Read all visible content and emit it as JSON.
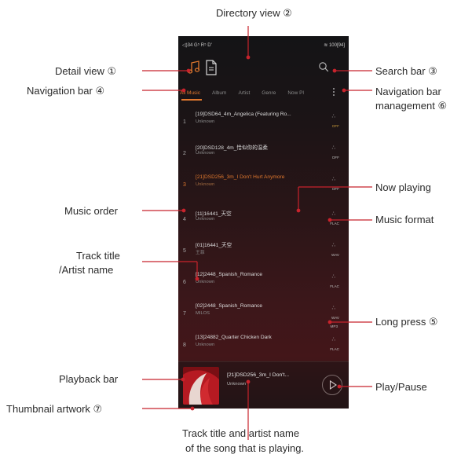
{
  "status": {
    "left": "◁)34 G⁵ R⁵ D'",
    "right": "100[94]"
  },
  "tabs": [
    {
      "label": "All Music",
      "active": true
    },
    {
      "label": "Album"
    },
    {
      "label": "Artist"
    },
    {
      "label": "Genre"
    },
    {
      "label": "Now Pl"
    }
  ],
  "tracks": [
    {
      "num": "1",
      "title": "[19]DSD64_4m_Angelica (Featuring Ro...",
      "artist": "Unknown",
      "format": "DFF"
    },
    {
      "num": "2",
      "title": "[20]DSD128_4m_恰似你的温柔",
      "artist": "Unknown",
      "format": "DFF"
    },
    {
      "num": "3",
      "title": "[21]DSD256_3m_I Don't Hurt Anymore",
      "artist": "Unknown",
      "format": "DFF",
      "playing": true
    },
    {
      "num": "4",
      "title": "[11]16441_天空",
      "artist": "Unknown",
      "format": "FLAC"
    },
    {
      "num": "5",
      "title": "[01]16441_天空",
      "artist": "王菲",
      "format": "WAV"
    },
    {
      "num": "6",
      "title": "[12]2448_Spanish_Romance",
      "artist": "Unknown",
      "format": "FLAC"
    },
    {
      "num": "7",
      "title": "[02]2448_Spanish_Romance",
      "artist": "MILOS",
      "format": "WAV"
    },
    {
      "num": "8",
      "title": "[13]24882_Quarter Chicken Dark",
      "artist": "Unknown",
      "format": "FLAC"
    }
  ],
  "extra_format": "MP3",
  "playback": {
    "title": "[21]DSD256_3m_I Don't...",
    "artist": "Unknown"
  },
  "annotations": {
    "directory_view": "Directory view ②",
    "detail_view": "Detail view ①",
    "search_bar": "Search bar ③",
    "navigation_bar": "Navigation bar ④",
    "nav_management_1": "Navigation bar",
    "nav_management_2": "management ⑥",
    "now_playing": "Now playing",
    "music_order": "Music order",
    "music_format": "Music format",
    "track_title_1": "Track title",
    "track_title_2": "/Artist name",
    "long_press": "Long press ⑤",
    "playback_bar": "Playback bar",
    "play_pause": "Play/Pause",
    "thumbnail": "Thumbnail artwork ⑦",
    "bottom_1": "Track title and artist name",
    "bottom_2": "of the song that is playing."
  },
  "colors": {
    "accent": "#e0782e",
    "annotation_line": "#c8232c"
  }
}
